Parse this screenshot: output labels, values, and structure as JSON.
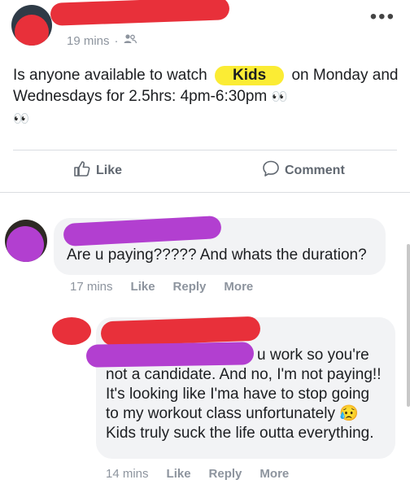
{
  "post": {
    "time": "19 mins",
    "separator": "·",
    "audience_icon": "friends-icon",
    "text_before": "Is anyone available to watch",
    "highlight": "Kids",
    "text_after": "on Monday and Wednesdays for 2.5hrs: 4pm-6:30pm",
    "emoji": "👀",
    "emoji_line2": "👀"
  },
  "actions": {
    "like_label": "Like",
    "comment_label": "Comment"
  },
  "comment1": {
    "text": "Are u paying????? And whats the duration?",
    "time": "17 mins",
    "like": "Like",
    "reply": "Reply",
    "more": "More"
  },
  "comment2": {
    "text_first": "u work so you're",
    "text_rest": "not a candidate. And no, I'm not paying!! It's looking like I'ma have to stop going to my workout class unfortunately",
    "emoji": "😥",
    "text_end": "Kids truly suck the life outta everything.",
    "time": "14 mins",
    "like": "Like",
    "reply": "Reply",
    "more": "More"
  },
  "colors": {
    "redact_red": "#e8303a",
    "redact_purple": "#b23fd0",
    "highlight_yellow": "#fbec34"
  }
}
